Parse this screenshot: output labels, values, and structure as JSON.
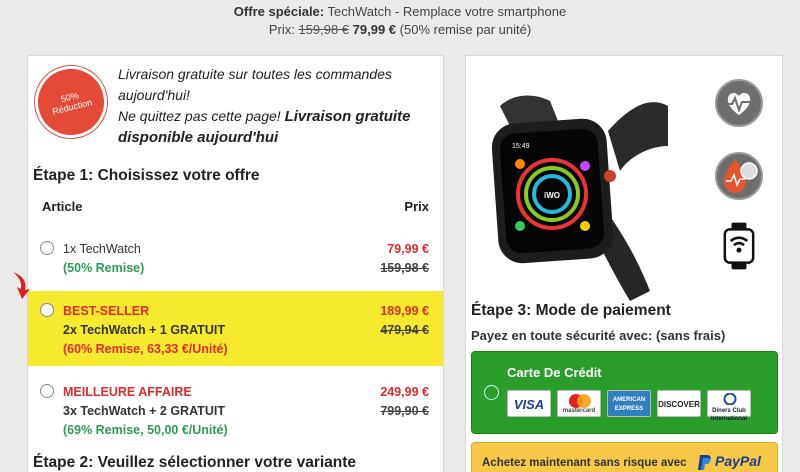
{
  "header": {
    "offer_label": "Offre spéciale:",
    "offer_text": " TechWatch - Remplace votre smartphone",
    "price_label": "Prix: ",
    "old_price": "159,98 €",
    "new_price": " 79,99 €",
    "discount_note": "  (50% remise par unité)"
  },
  "badge": {
    "line1": "50%",
    "line2": "Réduction"
  },
  "promo": {
    "line1": "Livraison gratuite sur toutes les commandes aujourd'hui!",
    "line2a": "Ne quittez pas cette page! ",
    "line2b": "Livraison gratuite disponible aujourd'hui"
  },
  "step1": {
    "title": "Étape 1: Choisissez votre offre",
    "col_article": "Article",
    "col_price": "Prix",
    "offers": [
      {
        "tag": "",
        "name": "1x TechWatch",
        "discount": "(50% Remise)",
        "price": "79,99 €",
        "old_price": "159,98 €",
        "selected": false
      },
      {
        "tag": "BEST-SELLER",
        "name": "2x TechWatch + 1 GRATUIT",
        "discount": "(60% Remise, 63,33 €/Unité)",
        "price": "189,99 €",
        "old_price": "479,94 €",
        "selected": true
      },
      {
        "tag": "MEILLEURE AFFAIRE",
        "name": "3x TechWatch + 2 GRATUIT",
        "discount": "(69% Remise, 50,00 €/Unité)",
        "price": "249,99 €",
        "old_price": "799,90 €",
        "selected": false
      }
    ]
  },
  "step2": {
    "title": "Étape 2: Veuillez sélectionner votre variante"
  },
  "step3": {
    "title": "Étape 3: Mode de paiement",
    "subtitle": "Payez en toute sécurité avec: (sans frais)",
    "credit_card_label": "Carte De Crédit",
    "cards": [
      "VISA",
      "mastercard",
      "AMERICAN EXPRESS",
      "DISCOVER",
      "Diners Club International"
    ],
    "paypal_text": "Achetez maintenant sans risque avec",
    "paypal_logo": "PayPal"
  },
  "watch_screen": {
    "time": "15:49",
    "brand": "iWO"
  },
  "feature_icons": [
    "heart-rate-icon",
    "blood-pressure-icon",
    "wifi-watch-icon"
  ],
  "colors": {
    "selected_bg": "#f6ea2f",
    "price_red": "#e02b2b",
    "discount_green": "#2e9c56",
    "cc_green": "#2a9d2a",
    "paypal_yellow": "#f7c748"
  }
}
